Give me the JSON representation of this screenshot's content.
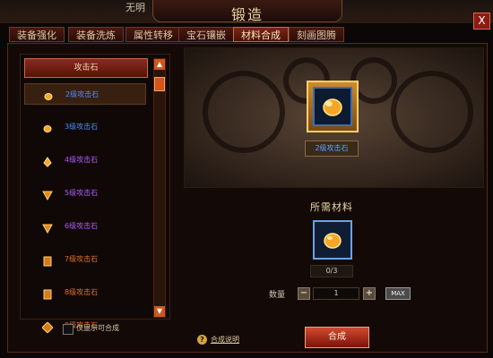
{
  "top": {
    "char_name": "无明"
  },
  "window": {
    "title": "锻造",
    "close_label": "X"
  },
  "tabs": [
    {
      "label": "装备强化",
      "active": false
    },
    {
      "label": "装备洗炼",
      "active": false
    },
    {
      "label": "属性转移",
      "active": false
    },
    {
      "label": "宝石镶嵌",
      "active": false
    },
    {
      "label": "材料合成",
      "active": true
    },
    {
      "label": "刻画图腾",
      "active": false
    }
  ],
  "list": {
    "header": "攻击石",
    "items": [
      {
        "label": "2级攻击石",
        "color": "#4a8cff",
        "selected": true,
        "icon": "ore-icon"
      },
      {
        "label": "3级攻击石",
        "color": "#4a8cff",
        "selected": false,
        "icon": "ore-icon"
      },
      {
        "label": "4级攻击石",
        "color": "#b05cff",
        "selected": false,
        "icon": "drop-gem-icon"
      },
      {
        "label": "5级攻击石",
        "color": "#b05cff",
        "selected": false,
        "icon": "triangle-gem-icon"
      },
      {
        "label": "6级攻击石",
        "color": "#b05cff",
        "selected": false,
        "icon": "triangle-gem-icon"
      },
      {
        "label": "7级攻击石",
        "color": "#e0702a",
        "selected": false,
        "icon": "square-gem-icon"
      },
      {
        "label": "8级攻击石",
        "color": "#e0702a",
        "selected": false,
        "icon": "square-gem-icon"
      },
      {
        "label": "9级攻击石",
        "color": "#e0702a",
        "selected": false,
        "icon": "diamond-gem-icon"
      }
    ],
    "only_craftable_label": "仅显示可合成"
  },
  "result": {
    "label": "2级攻击石"
  },
  "materials": {
    "title": "所需材料",
    "count": "0/3"
  },
  "quantity": {
    "label": "数量",
    "value": "1",
    "minus": "−",
    "plus": "+",
    "max": "MAX"
  },
  "footer": {
    "help_icon": "?",
    "help_link": "合成说明",
    "synthesize_label": "合成"
  },
  "colors": {
    "accent": "#d0561a",
    "frame": "#5b2a18",
    "rare_blue": "#4a8cff",
    "epic_purple": "#b05cff",
    "legend_orange": "#e0702a"
  }
}
